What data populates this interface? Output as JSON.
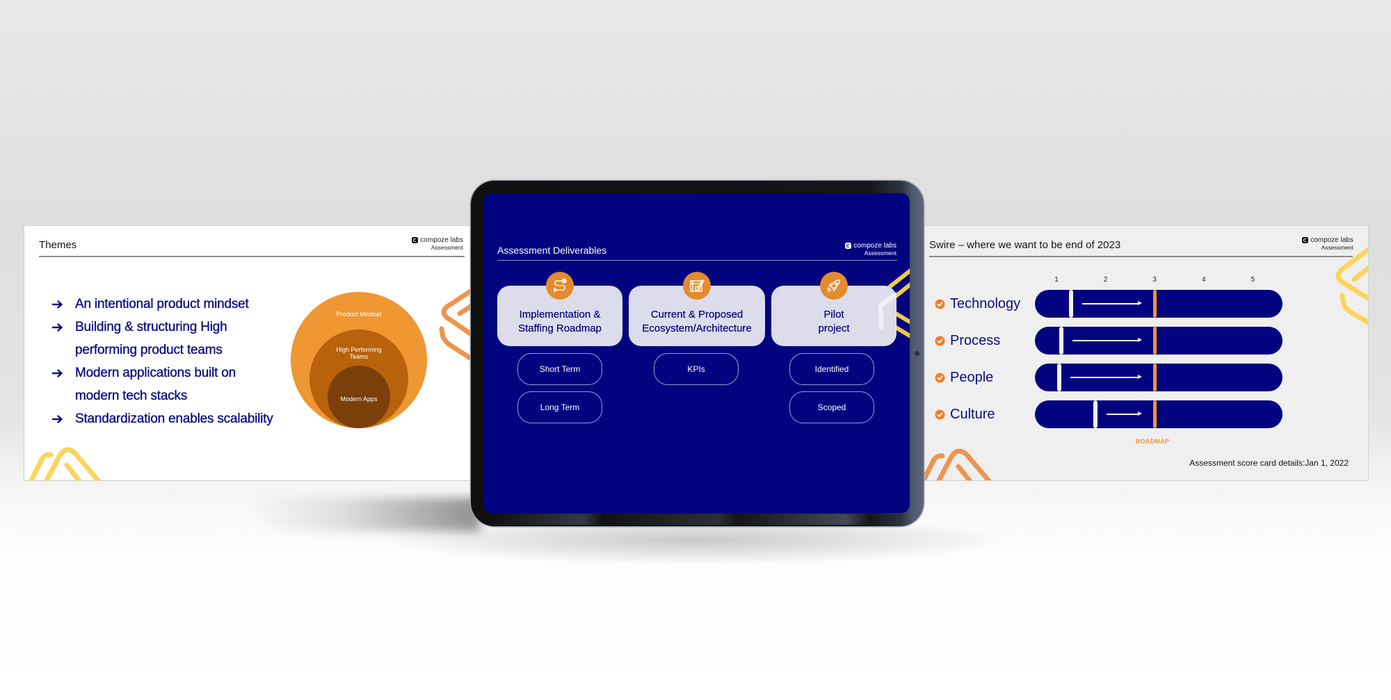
{
  "left_slide": {
    "title": "Themes",
    "brand": {
      "name": "compoze labs",
      "subtitle": "Assessment"
    },
    "bullets": [
      {
        "line1": "An intentional product mindset",
        "line2": ""
      },
      {
        "line1": "Building & structuring High",
        "line2": "performing product teams"
      },
      {
        "line1": "Modern applications built on",
        "line2": "modern tech stacks"
      },
      {
        "line1": "Standardization enables scalability",
        "line2": ""
      }
    ],
    "circles": {
      "outer": "Product Mindset",
      "middle_line1": "High Performing",
      "middle_line2": "Teams",
      "inner": "Modern Apps"
    }
  },
  "tablet": {
    "title": "Assessment Deliverables",
    "brand": {
      "name": "compoze labs",
      "subtitle": "Assessment"
    },
    "deliverables": [
      {
        "icon": "roadmap-icon",
        "line1": "Implementation &",
        "line2": "Staffing Roadmap",
        "items": [
          "Short Term",
          "Long Term"
        ]
      },
      {
        "icon": "blueprint-icon",
        "line1": "Current & Proposed",
        "line2": "Ecosystem/Architecture",
        "items": [
          "KPIs"
        ]
      },
      {
        "icon": "rocket-icon",
        "line1": "Pilot",
        "line2": "project",
        "items": [
          "Identified",
          "Scoped"
        ]
      }
    ]
  },
  "right_slide": {
    "title": "Swire – where we want to be end of 2023",
    "brand": {
      "name": "compoze labs",
      "subtitle": "Assessment"
    },
    "scale": [
      "1",
      "2",
      "3",
      "4",
      "5"
    ],
    "scale_min": 1,
    "scale_max": 5,
    "rows": [
      {
        "label": "Technology",
        "current": 1.3,
        "target": 3
      },
      {
        "label": "Process",
        "current": 1.1,
        "target": 3
      },
      {
        "label": "People",
        "current": 1.05,
        "target": 3
      },
      {
        "label": "Culture",
        "current": 1.8,
        "target": 3
      }
    ],
    "axis_caption": "ROADMAP",
    "footnote": "Assessment score card details:Jan 1, 2022"
  },
  "colors": {
    "navy": "#02037f",
    "orange": "#ee9733",
    "lavender": "#dcdcea",
    "yellow": "#fdd458",
    "circle_outer": "#ee9733",
    "circle_middle": "#b8620c",
    "circle_inner": "#7a3f0b"
  }
}
